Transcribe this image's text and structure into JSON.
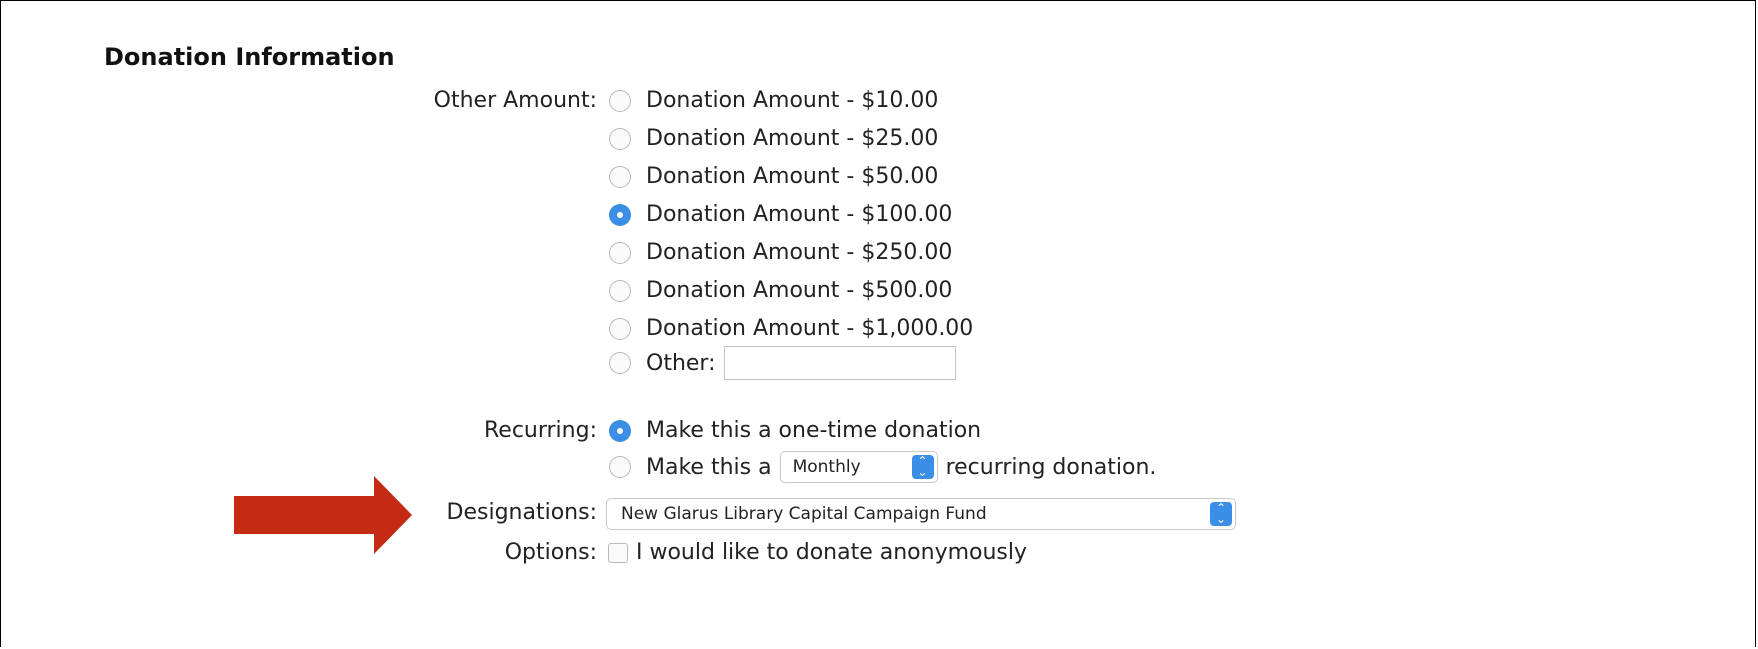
{
  "section": {
    "title": "Donation Information"
  },
  "amount": {
    "label": "Other Amount:",
    "options": [
      {
        "label": "Donation Amount - $10.00",
        "checked": false
      },
      {
        "label": "Donation Amount - $25.00",
        "checked": false
      },
      {
        "label": "Donation Amount - $50.00",
        "checked": false
      },
      {
        "label": "Donation Amount - $100.00",
        "checked": true
      },
      {
        "label": "Donation Amount - $250.00",
        "checked": false
      },
      {
        "label": "Donation Amount - $500.00",
        "checked": false
      },
      {
        "label": "Donation Amount - $1,000.00",
        "checked": false
      }
    ],
    "other_label": "Other:",
    "other_value": ""
  },
  "recurring": {
    "label": "Recurring:",
    "one_time_label": "Make this a one-time donation",
    "one_time_checked": true,
    "recurring_prefix": "Make this a",
    "frequency_value": "Monthly",
    "recurring_suffix": "recurring donation.",
    "recurring_checked": false
  },
  "designations": {
    "label": "Designations:",
    "selected": "New Glarus Library Capital Campaign Fund"
  },
  "options": {
    "label": "Options:",
    "anonymous_label": "I would like to donate anonymously",
    "anonymous_checked": false
  },
  "colors": {
    "accent": "#3b8ee6",
    "arrow": "#c42b12"
  },
  "icons": {
    "arrow": "right-arrow-icon",
    "stepper": "up-down-chevron-icon"
  }
}
